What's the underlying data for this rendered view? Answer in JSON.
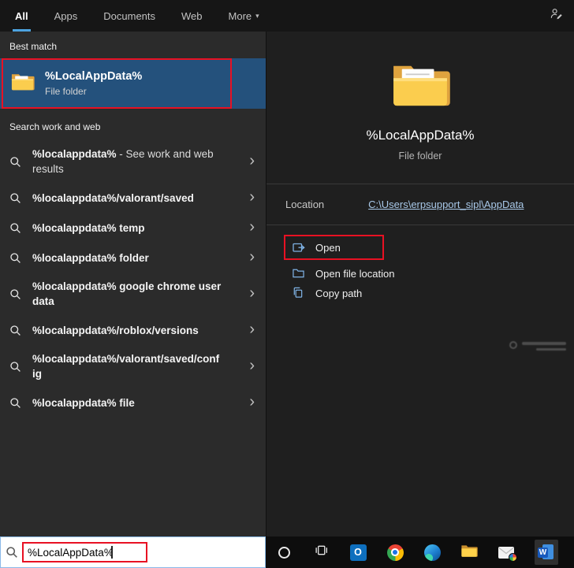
{
  "colors": {
    "accent_blue": "#4da3e0",
    "selection_blue": "#24517c",
    "annotation_red": "#e81123",
    "icon_blue": "#7fb2e5",
    "link_blue": "#a8c8e8"
  },
  "icons": {
    "chevron_right": "›",
    "dropdown_caret": "▾",
    "outlook_letter": "O",
    "word_letter": "W"
  },
  "top_tabs": [
    {
      "label": "All",
      "active": true
    },
    {
      "label": "Apps",
      "active": false
    },
    {
      "label": "Documents",
      "active": false
    },
    {
      "label": "Web",
      "active": false
    },
    {
      "label": "More",
      "active": false,
      "has_caret": true
    }
  ],
  "left_panel": {
    "best_match_label": "Best match",
    "best_match": {
      "title": "%LocalAppData%",
      "subtitle": "File folder"
    },
    "search_web_label": "Search work and web"
  },
  "suggestions": [
    {
      "bold": "%localappdata%",
      "rest": " - See work and web results"
    },
    {
      "bold": "%localappdata%/valorant/saved",
      "rest": ""
    },
    {
      "bold": "%localappdata% temp",
      "rest": ""
    },
    {
      "bold": "%localappdata% folder",
      "rest": ""
    },
    {
      "bold": "%localappdata% google chrome user data",
      "rest": ""
    },
    {
      "bold": "%localappdata%/roblox/versions",
      "rest": ""
    },
    {
      "bold": "%localappdata%/valorant/saved/config",
      "rest": ""
    },
    {
      "bold": "%localappdata% file",
      "rest": ""
    }
  ],
  "detail": {
    "title": "%LocalAppData%",
    "subtitle": "File folder",
    "location_label": "Location",
    "location_value": "C:\\Users\\erpsupport_sipl\\AppData",
    "actions": [
      {
        "label": "Open"
      },
      {
        "label": "Open file location"
      },
      {
        "label": "Copy path"
      }
    ]
  },
  "taskbar": {
    "search_value": "%LocalAppData%",
    "icons": [
      "cortana",
      "task-view",
      "outlook",
      "chrome",
      "edge",
      "file-explorer",
      "mail",
      "word"
    ]
  }
}
